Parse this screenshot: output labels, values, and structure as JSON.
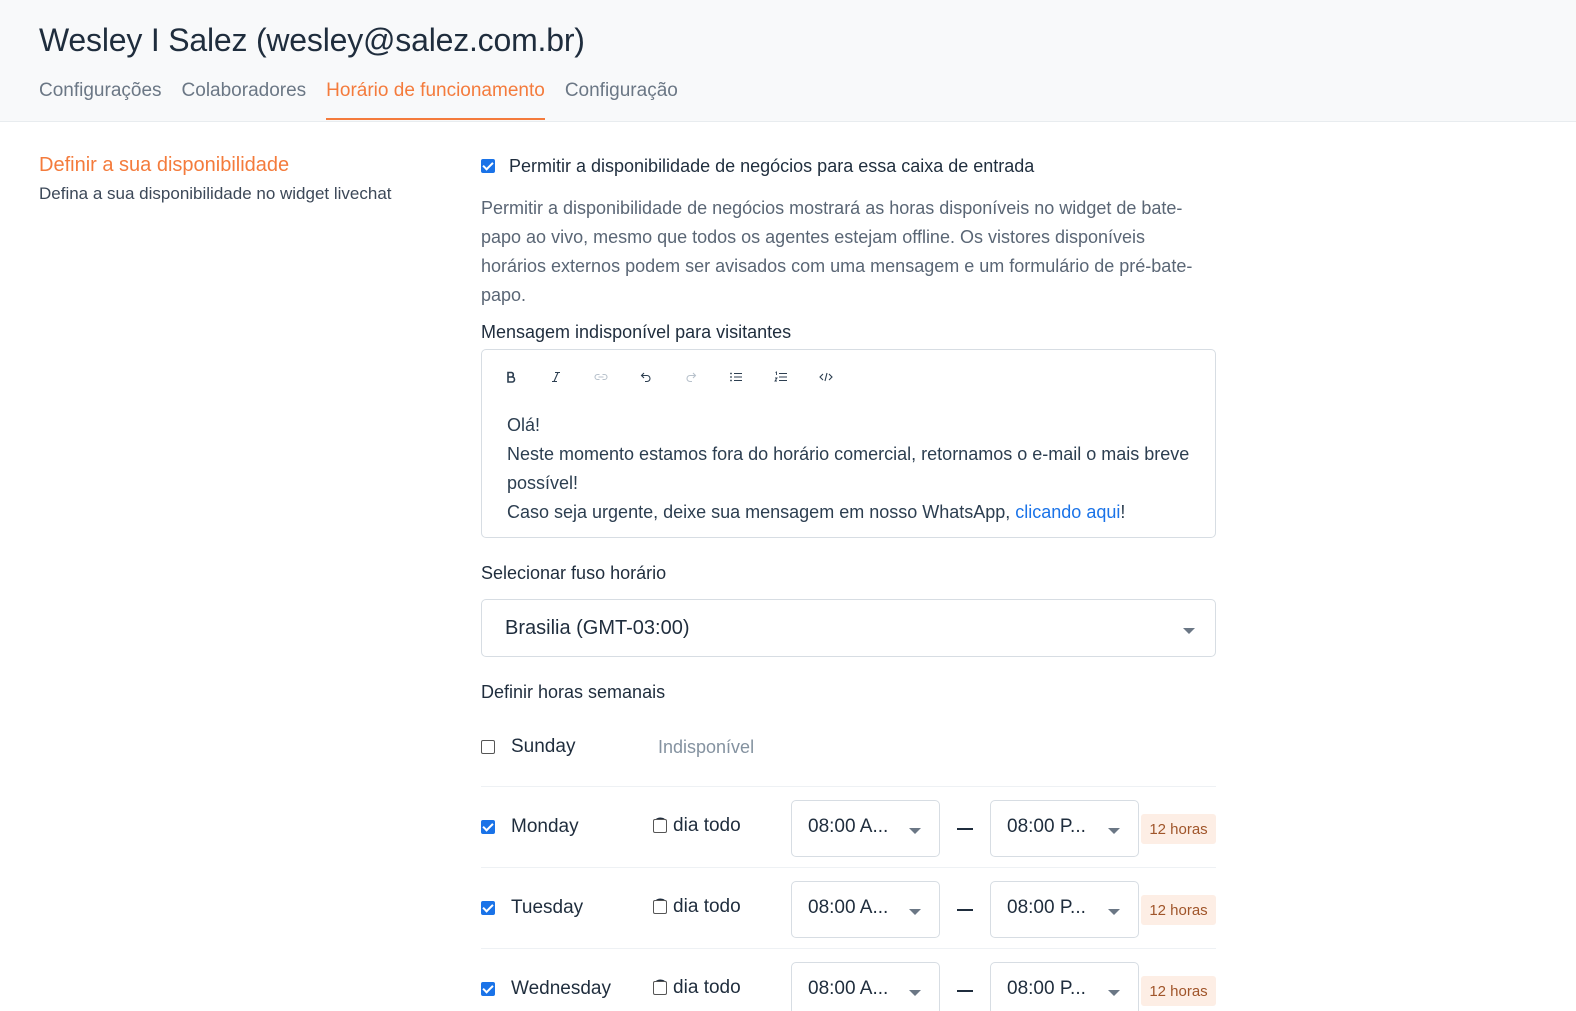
{
  "header": {
    "title": "Wesley I Salez (wesley@salez.com.br)",
    "tabs": [
      {
        "label": "Configurações",
        "active": false
      },
      {
        "label": "Colaboradores",
        "active": false
      },
      {
        "label": "Horário de funcionamento",
        "active": true
      },
      {
        "label": "Configuração",
        "active": false
      }
    ]
  },
  "section": {
    "title": "Definir a sua disponibilidade",
    "description": "Defina a sua disponibilidade no widget livechat"
  },
  "availability": {
    "enabled": true,
    "label": "Permitir a disponibilidade de negócios para essa caixa de entrada",
    "help": "Permitir a disponibilidade de negócios mostrará as horas disponíveis no widget de bate-papo ao vivo, mesmo que todos os agentes estejam offline. Os vistores disponíveis horários externos podem ser avisados com uma mensagem e um formulário de pré-bate-papo."
  },
  "message": {
    "label": "Mensagem indisponível para visitantes",
    "toolbar": [
      "bold-icon",
      "italic-icon",
      "link-icon",
      "undo-icon",
      "redo-icon",
      "bullet-list-icon",
      "ordered-list-icon",
      "code-icon"
    ],
    "line1": "Olá!",
    "line2": "Neste momento estamos fora do horário comercial, retornamos o e-mail o mais breve possível!",
    "line3_prefix": "Caso seja urgente, deixe sua mensagem em nosso WhatsApp, ",
    "line3_link": "clicando aqui",
    "line3_suffix": "!"
  },
  "timezone": {
    "label": "Selecionar fuso horário",
    "value": "Brasilia (GMT-03:00)"
  },
  "weekly": {
    "label": "Definir horas semanais",
    "days": [
      {
        "name": "Sunday",
        "enabled": false,
        "status": "Indisponível"
      },
      {
        "name": "Monday",
        "enabled": true,
        "all_day_label": "O dia todo",
        "all_day": false,
        "from": "08:00 A...",
        "to": "08:00 P...",
        "hours": "12 horas"
      },
      {
        "name": "Tuesday",
        "enabled": true,
        "all_day_label": "O dia todo",
        "all_day": false,
        "from": "08:00 A...",
        "to": "08:00 P...",
        "hours": "12 horas"
      },
      {
        "name": "Wednesday",
        "enabled": true,
        "all_day_label": "O dia todo",
        "all_day": false,
        "from": "08:00 A...",
        "to": "08:00 P...",
        "hours": "12 horas"
      }
    ]
  },
  "colors": {
    "accent": "#f47b3c",
    "link": "#1a73e8",
    "checkbox": "#1a73e8"
  }
}
